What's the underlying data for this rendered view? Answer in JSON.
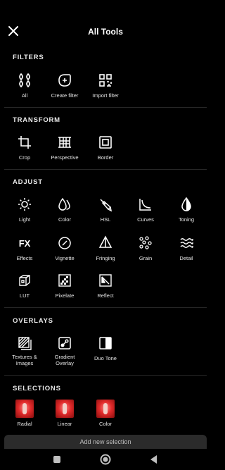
{
  "header": {
    "title": "All Tools",
    "close_icon": "close-icon"
  },
  "sections": {
    "filters": {
      "title": "FILTERS",
      "items": [
        {
          "label": "All",
          "icon": "grid-icon"
        },
        {
          "label": "Create filter",
          "icon": "add-filter-icon"
        },
        {
          "label": "Import filter",
          "icon": "qr-import-icon"
        }
      ]
    },
    "transform": {
      "title": "TRANSFORM",
      "items": [
        {
          "label": "Crop",
          "icon": "crop-icon"
        },
        {
          "label": "Perspective",
          "icon": "perspective-icon"
        },
        {
          "label": "Border",
          "icon": "border-icon"
        }
      ]
    },
    "adjust": {
      "title": "ADJUST",
      "items": [
        {
          "label": "Light",
          "icon": "sun-icon"
        },
        {
          "label": "Color",
          "icon": "droplets-icon"
        },
        {
          "label": "HSL",
          "icon": "brush-icon"
        },
        {
          "label": "Curves",
          "icon": "curves-icon"
        },
        {
          "label": "Toning",
          "icon": "drop-icon"
        },
        {
          "label": "Effects",
          "icon": "fx-icon"
        },
        {
          "label": "Vignette",
          "icon": "vignette-icon"
        },
        {
          "label": "Fringing",
          "icon": "prism-icon"
        },
        {
          "label": "Grain",
          "icon": "grain-icon"
        },
        {
          "label": "Detail",
          "icon": "waves-icon"
        },
        {
          "label": "LUT",
          "icon": "lut-icon"
        },
        {
          "label": "Pixelate",
          "icon": "pixelate-icon"
        },
        {
          "label": "Reflect",
          "icon": "reflect-icon"
        }
      ]
    },
    "overlays": {
      "title": "OVERLAYS",
      "items": [
        {
          "label": "Textures & Images",
          "icon": "texture-icon"
        },
        {
          "label": "Gradient Overlay",
          "icon": "gradient-icon"
        },
        {
          "label": "Duo Tone",
          "icon": "duotone-icon"
        }
      ]
    },
    "selections": {
      "title": "SELECTIONS",
      "items": [
        {
          "label": "Radial",
          "icon": "radial-thumb"
        },
        {
          "label": "Linear",
          "icon": "linear-thumb"
        },
        {
          "label": "Color",
          "icon": "color-thumb"
        }
      ],
      "add_label": "Add new selection"
    }
  },
  "navbar": {
    "items": [
      "square-icon",
      "circle-icon",
      "back-triangle-icon"
    ]
  }
}
